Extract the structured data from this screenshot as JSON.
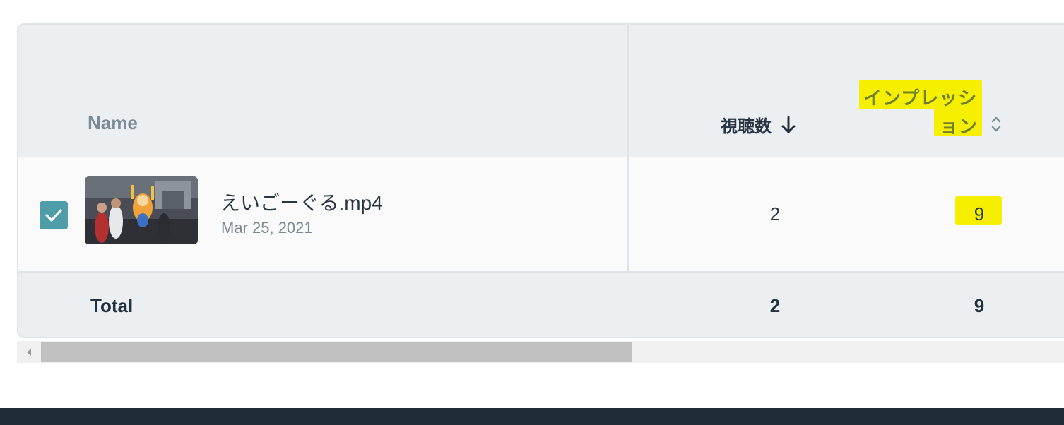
{
  "table": {
    "columns": {
      "name": "Name",
      "views": "視聴数",
      "impressions_line1": "インプレッシ",
      "impressions_line2": "ョン"
    },
    "rows": [
      {
        "selected": true,
        "file_name": "えいごーぐる.mp4",
        "date": "Mar 25, 2021",
        "views": "2",
        "impressions": "9"
      }
    ],
    "total": {
      "label": "Total",
      "views": "2",
      "impressions": "9"
    },
    "sort": {
      "column": "views",
      "direction": "descending"
    }
  },
  "colors": {
    "highlight": "#f6f000",
    "checkbox": "#4e9da8",
    "footer": "#202d38"
  },
  "icons": {
    "sort_active": "arrow-down-icon",
    "sort_inactive": "sort-updown-icon",
    "checkbox": "check-icon",
    "scroll": "chevron-left-icon"
  }
}
